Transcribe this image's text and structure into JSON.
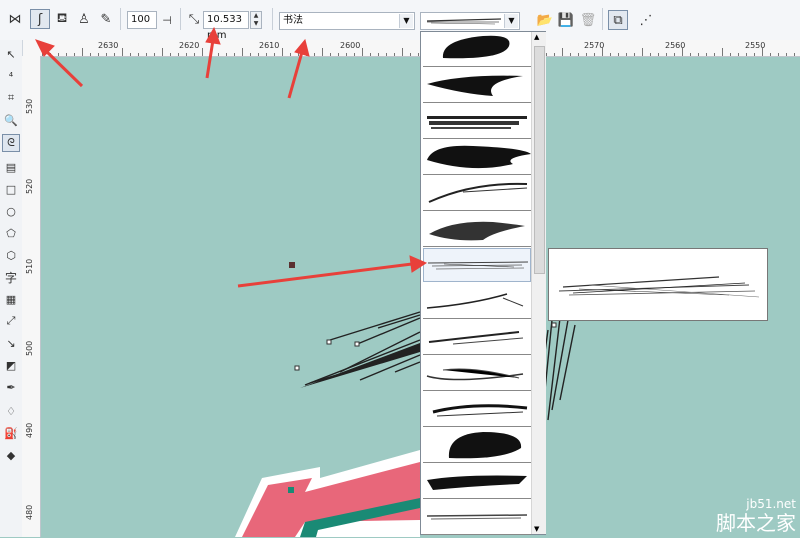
{
  "property_bar": {
    "smoothing_value": "100",
    "width_value": "10.533 mm",
    "category_value": "书法",
    "tools": [
      "preset-tool",
      "brush-tool",
      "sprayer-tool",
      "calligraphic-tool",
      "pressure-tool"
    ]
  },
  "ruler_top": {
    "labels": [
      "2630",
      "2620",
      "2610",
      "2600",
      "2570",
      "2560",
      "2550"
    ]
  },
  "ruler_left": {
    "labels": [
      "530",
      "520",
      "510",
      "500",
      "490",
      "480"
    ]
  },
  "brush_list": {
    "item_count": 14,
    "selected_index": 6
  },
  "watermark": {
    "site": "jb51.net",
    "name": "脚本之家"
  },
  "colors": {
    "canvas": "#9ecac3",
    "arrow": "#e8403a",
    "pink": "#e8677a",
    "teal": "#1a8a75"
  }
}
